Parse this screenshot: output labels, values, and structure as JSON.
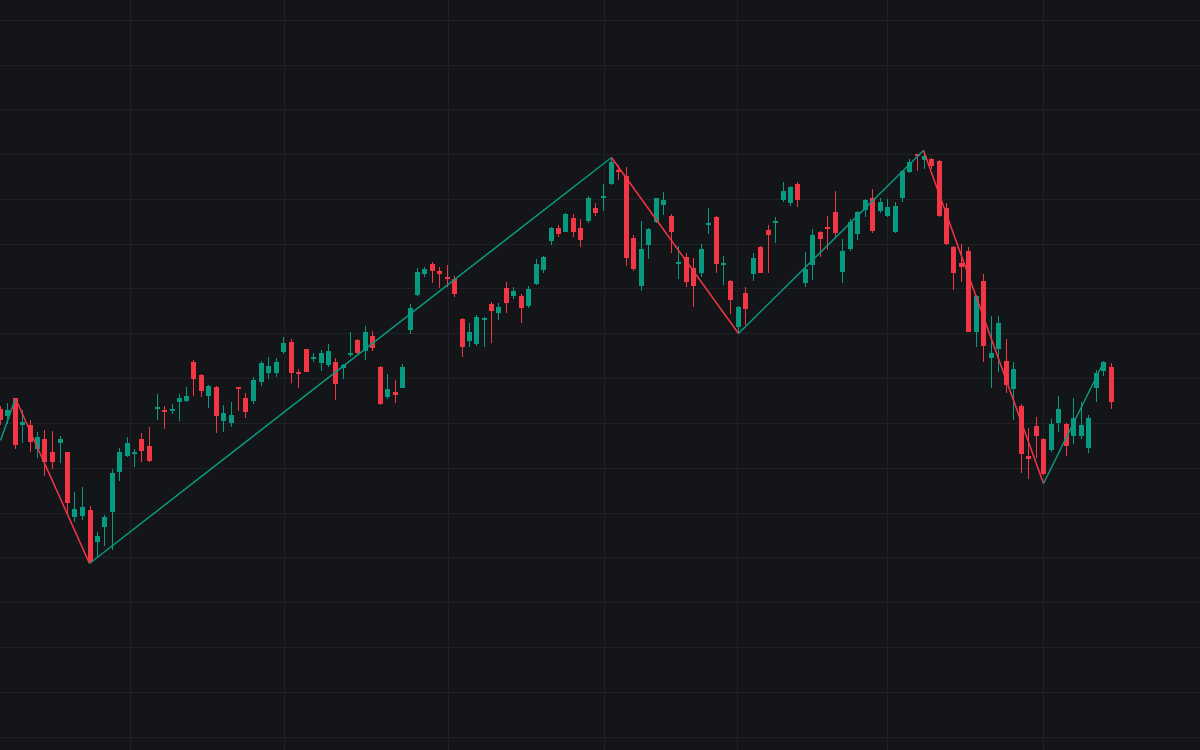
{
  "price_chart": {
    "series": [
      {
        "kind": "rising",
        "color": "#089981"
      },
      {
        "kind": "falling",
        "color": "#f23645"
      }
    ]
  }
}
